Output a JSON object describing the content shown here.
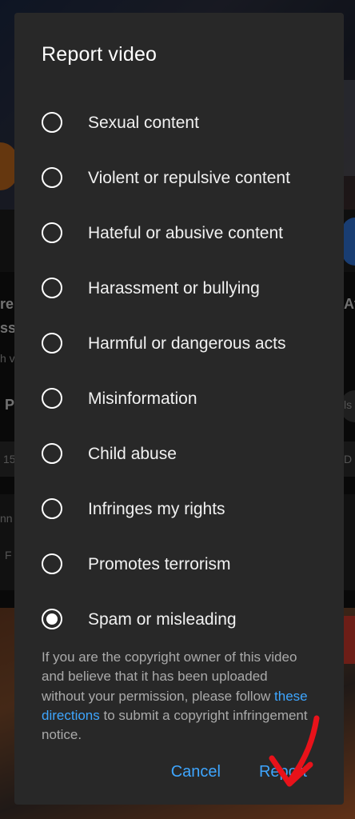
{
  "background": {
    "fragments": [
      {
        "text": "re"
      },
      {
        "text": "ss"
      },
      {
        "text": "h v"
      },
      {
        "text": "P"
      },
      {
        "text": "15"
      },
      {
        "text": "nn"
      },
      {
        "text": "F"
      },
      {
        "text": "At"
      },
      {
        "text": "ls"
      },
      {
        "text": "D"
      }
    ]
  },
  "dialog": {
    "title": "Report video",
    "options": [
      {
        "label": "Sexual content",
        "selected": false
      },
      {
        "label": "Violent or repulsive content",
        "selected": false
      },
      {
        "label": "Hateful or abusive content",
        "selected": false
      },
      {
        "label": "Harassment or bullying",
        "selected": false
      },
      {
        "label": "Harmful or dangerous acts",
        "selected": false
      },
      {
        "label": "Misinformation",
        "selected": false
      },
      {
        "label": "Child abuse",
        "selected": false
      },
      {
        "label": "Infringes my rights",
        "selected": false
      },
      {
        "label": "Promotes terrorism",
        "selected": false
      },
      {
        "label": "Spam or misleading",
        "selected": true
      }
    ],
    "notice": {
      "before": "If you are the copyright owner of this video and believe that it has been uploaded without your permission, please follow ",
      "link": "these directions",
      "after": " to submit a copyright infringement notice."
    },
    "cancel_label": "Cancel",
    "report_label": "Report"
  },
  "colors": {
    "dialog_bg": "#282828",
    "accent": "#3ea6ff",
    "annotation": "#e8121a"
  }
}
